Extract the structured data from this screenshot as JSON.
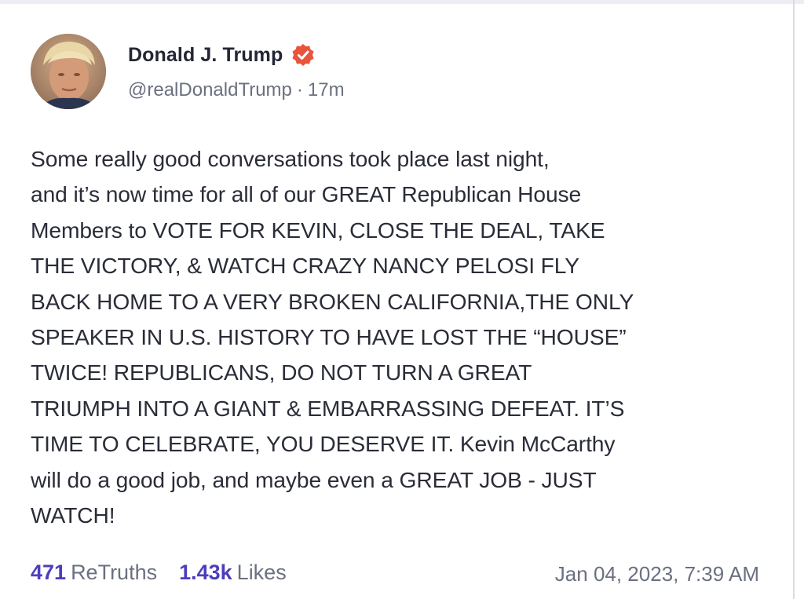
{
  "post": {
    "author": {
      "display_name": "Donald J. Trump",
      "handle": "@realDonaldTrump",
      "verified": true,
      "verified_icon": "verified-badge-icon",
      "avatar_icon": "avatar-photo"
    },
    "separator": "·",
    "relative_time": "17m",
    "body": "Some really good conversations took place last night,\nand it’s now time for all of our GREAT Republican House\nMembers to VOTE FOR KEVIN, CLOSE THE DEAL, TAKE\nTHE VICTORY, & WATCH CRAZY NANCY PELOSI FLY\nBACK HOME TO A VERY BROKEN CALIFORNIA,THE ONLY\nSPEAKER IN U.S. HISTORY TO HAVE LOST THE “HOUSE”\nTWICE! REPUBLICANS, DO NOT TURN A GREAT\nTRIUMPH INTO A GIANT & EMBARRASSING DEFEAT. IT’S\nTIME TO CELEBRATE, YOU DESERVE IT. Kevin McCarthy\nwill do a good job, and maybe even a GREAT JOB - JUST\nWATCH!",
    "stats": {
      "retruths_count": "471",
      "retruths_label": "ReTruths",
      "likes_count": "1.43k",
      "likes_label": "Likes"
    },
    "timestamp": "Jan 04, 2023, 7:39 AM"
  },
  "colors": {
    "accent": "#4c3ebc",
    "verified_badge": "#e8543c",
    "text_primary": "#2a2d38",
    "text_secondary": "#6b7080"
  }
}
